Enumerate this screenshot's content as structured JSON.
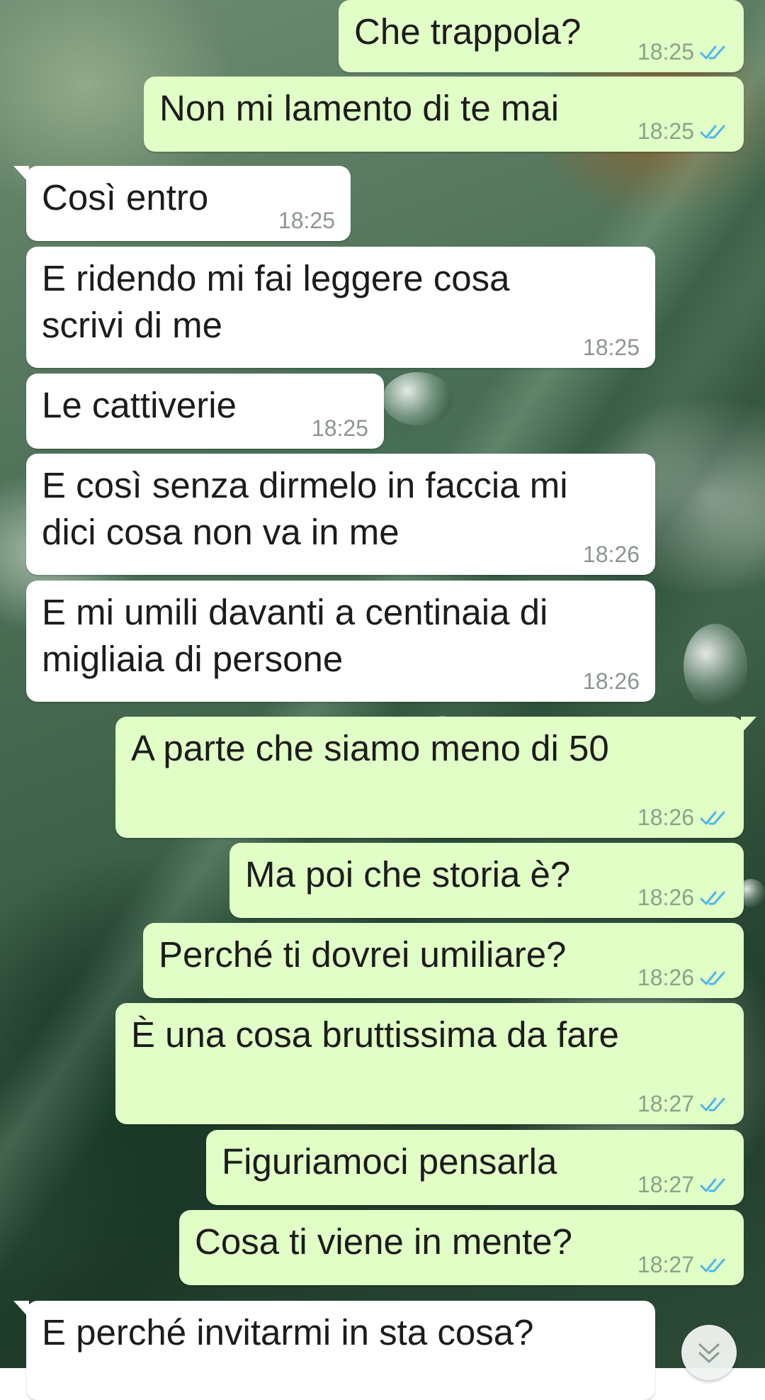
{
  "chat": {
    "messages": [
      {
        "direction": "out",
        "text": "Che trappola?",
        "time": "18:25",
        "status": "read"
      },
      {
        "direction": "out",
        "text": "Non mi lamento di te mai",
        "time": "18:25",
        "status": "read"
      },
      {
        "direction": "in",
        "text": "Così entro",
        "time": "18:25"
      },
      {
        "direction": "in",
        "text": "E ridendo mi fai leggere cosa\nscrivi di me",
        "time": "18:25"
      },
      {
        "direction": "in",
        "text": "Le cattiverie",
        "time": "18:25"
      },
      {
        "direction": "in",
        "text": "E così senza dirmelo in faccia mi\ndici cosa non va in me",
        "time": "18:26"
      },
      {
        "direction": "in",
        "text": "E mi umili davanti a centinaia di\nmigliaia di persone",
        "time": "18:26"
      },
      {
        "direction": "out",
        "text": "A parte che siamo meno di 50",
        "time": "18:26",
        "status": "read"
      },
      {
        "direction": "out",
        "text": "Ma poi che storia è?",
        "time": "18:26",
        "status": "read"
      },
      {
        "direction": "out",
        "text": "Perché ti dovrei umiliare?",
        "time": "18:26",
        "status": "read"
      },
      {
        "direction": "out",
        "text": "È una cosa bruttissima da fare",
        "time": "18:27",
        "status": "read"
      },
      {
        "direction": "out",
        "text": "Figuriamoci pensarla",
        "time": "18:27",
        "status": "read"
      },
      {
        "direction": "out",
        "text": "Cosa ti viene in mente?",
        "time": "18:27",
        "status": "read"
      },
      {
        "direction": "in",
        "text": "E perché invitarmi in sta cosa?",
        "time": ""
      }
    ]
  },
  "icons": {
    "read_receipt": "double-check-icon",
    "scroll_down": "chevron-double-down-icon"
  },
  "colors": {
    "incoming_bubble": "#ffffff",
    "outgoing_bubble": "#e1fec6",
    "read_tick": "#4fb6ec",
    "timestamp": "#8c9690"
  }
}
